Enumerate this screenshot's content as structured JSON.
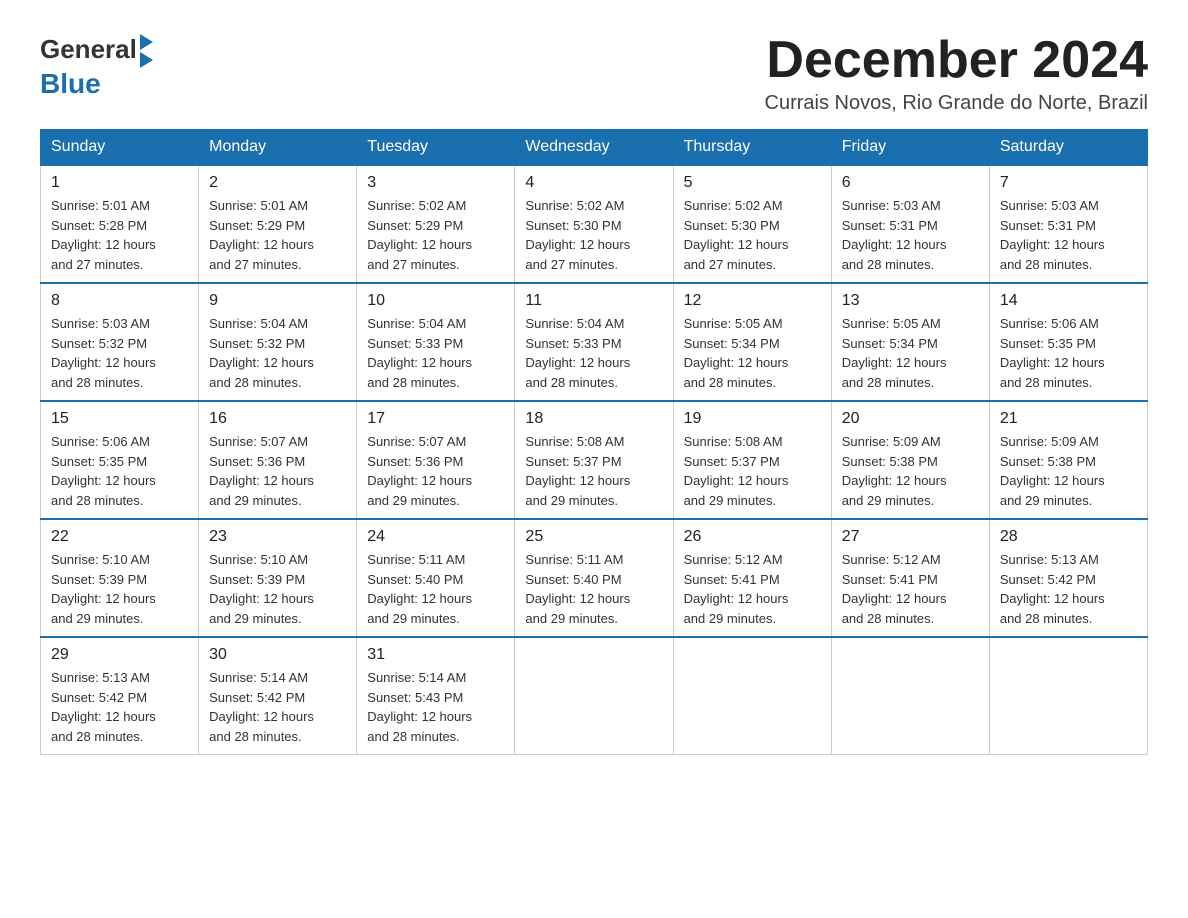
{
  "header": {
    "logo_general": "General",
    "logo_blue": "Blue",
    "month_title": "December 2024",
    "location": "Currais Novos, Rio Grande do Norte, Brazil"
  },
  "days_of_week": [
    "Sunday",
    "Monday",
    "Tuesday",
    "Wednesday",
    "Thursday",
    "Friday",
    "Saturday"
  ],
  "weeks": [
    [
      {
        "day": "1",
        "sunrise": "5:01 AM",
        "sunset": "5:28 PM",
        "daylight": "12 hours and 27 minutes."
      },
      {
        "day": "2",
        "sunrise": "5:01 AM",
        "sunset": "5:29 PM",
        "daylight": "12 hours and 27 minutes."
      },
      {
        "day": "3",
        "sunrise": "5:02 AM",
        "sunset": "5:29 PM",
        "daylight": "12 hours and 27 minutes."
      },
      {
        "day": "4",
        "sunrise": "5:02 AM",
        "sunset": "5:30 PM",
        "daylight": "12 hours and 27 minutes."
      },
      {
        "day": "5",
        "sunrise": "5:02 AM",
        "sunset": "5:30 PM",
        "daylight": "12 hours and 27 minutes."
      },
      {
        "day": "6",
        "sunrise": "5:03 AM",
        "sunset": "5:31 PM",
        "daylight": "12 hours and 28 minutes."
      },
      {
        "day": "7",
        "sunrise": "5:03 AM",
        "sunset": "5:31 PM",
        "daylight": "12 hours and 28 minutes."
      }
    ],
    [
      {
        "day": "8",
        "sunrise": "5:03 AM",
        "sunset": "5:32 PM",
        "daylight": "12 hours and 28 minutes."
      },
      {
        "day": "9",
        "sunrise": "5:04 AM",
        "sunset": "5:32 PM",
        "daylight": "12 hours and 28 minutes."
      },
      {
        "day": "10",
        "sunrise": "5:04 AM",
        "sunset": "5:33 PM",
        "daylight": "12 hours and 28 minutes."
      },
      {
        "day": "11",
        "sunrise": "5:04 AM",
        "sunset": "5:33 PM",
        "daylight": "12 hours and 28 minutes."
      },
      {
        "day": "12",
        "sunrise": "5:05 AM",
        "sunset": "5:34 PM",
        "daylight": "12 hours and 28 minutes."
      },
      {
        "day": "13",
        "sunrise": "5:05 AM",
        "sunset": "5:34 PM",
        "daylight": "12 hours and 28 minutes."
      },
      {
        "day": "14",
        "sunrise": "5:06 AM",
        "sunset": "5:35 PM",
        "daylight": "12 hours and 28 minutes."
      }
    ],
    [
      {
        "day": "15",
        "sunrise": "5:06 AM",
        "sunset": "5:35 PM",
        "daylight": "12 hours and 28 minutes."
      },
      {
        "day": "16",
        "sunrise": "5:07 AM",
        "sunset": "5:36 PM",
        "daylight": "12 hours and 29 minutes."
      },
      {
        "day": "17",
        "sunrise": "5:07 AM",
        "sunset": "5:36 PM",
        "daylight": "12 hours and 29 minutes."
      },
      {
        "day": "18",
        "sunrise": "5:08 AM",
        "sunset": "5:37 PM",
        "daylight": "12 hours and 29 minutes."
      },
      {
        "day": "19",
        "sunrise": "5:08 AM",
        "sunset": "5:37 PM",
        "daylight": "12 hours and 29 minutes."
      },
      {
        "day": "20",
        "sunrise": "5:09 AM",
        "sunset": "5:38 PM",
        "daylight": "12 hours and 29 minutes."
      },
      {
        "day": "21",
        "sunrise": "5:09 AM",
        "sunset": "5:38 PM",
        "daylight": "12 hours and 29 minutes."
      }
    ],
    [
      {
        "day": "22",
        "sunrise": "5:10 AM",
        "sunset": "5:39 PM",
        "daylight": "12 hours and 29 minutes."
      },
      {
        "day": "23",
        "sunrise": "5:10 AM",
        "sunset": "5:39 PM",
        "daylight": "12 hours and 29 minutes."
      },
      {
        "day": "24",
        "sunrise": "5:11 AM",
        "sunset": "5:40 PM",
        "daylight": "12 hours and 29 minutes."
      },
      {
        "day": "25",
        "sunrise": "5:11 AM",
        "sunset": "5:40 PM",
        "daylight": "12 hours and 29 minutes."
      },
      {
        "day": "26",
        "sunrise": "5:12 AM",
        "sunset": "5:41 PM",
        "daylight": "12 hours and 29 minutes."
      },
      {
        "day": "27",
        "sunrise": "5:12 AM",
        "sunset": "5:41 PM",
        "daylight": "12 hours and 28 minutes."
      },
      {
        "day": "28",
        "sunrise": "5:13 AM",
        "sunset": "5:42 PM",
        "daylight": "12 hours and 28 minutes."
      }
    ],
    [
      {
        "day": "29",
        "sunrise": "5:13 AM",
        "sunset": "5:42 PM",
        "daylight": "12 hours and 28 minutes."
      },
      {
        "day": "30",
        "sunrise": "5:14 AM",
        "sunset": "5:42 PM",
        "daylight": "12 hours and 28 minutes."
      },
      {
        "day": "31",
        "sunrise": "5:14 AM",
        "sunset": "5:43 PM",
        "daylight": "12 hours and 28 minutes."
      },
      null,
      null,
      null,
      null
    ]
  ],
  "labels": {
    "sunrise": "Sunrise:",
    "sunset": "Sunset:",
    "daylight": "Daylight:"
  }
}
